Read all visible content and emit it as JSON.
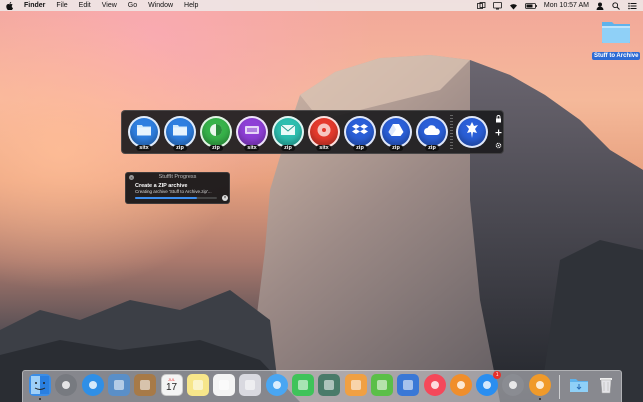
{
  "menubar": {
    "app_name": "Finder",
    "menus": [
      "File",
      "Edit",
      "View",
      "Go",
      "Window",
      "Help"
    ],
    "clock": "Mon 10:57 AM"
  },
  "desktop": {
    "folder_label": "Stuff to Archive"
  },
  "dropbar": {
    "items": [
      {
        "tag": "sitx",
        "icon": "folder-icon",
        "color": "#2f7fe0"
      },
      {
        "tag": "zip",
        "icon": "folder-icon",
        "color": "#2f7fe0"
      },
      {
        "tag": "zip",
        "icon": "share-icon",
        "color": "#37b34a"
      },
      {
        "tag": "sitx",
        "icon": "disc-image-icon",
        "color": "#8e3fd6"
      },
      {
        "tag": "zip",
        "icon": "mail-icon",
        "color": "#2dbfb0"
      },
      {
        "tag": "sitx",
        "icon": "burn-disc-icon",
        "color": "#e53a2c"
      },
      {
        "tag": "zip",
        "icon": "dropbox-icon",
        "color": "#2a5fd8"
      },
      {
        "tag": "zip",
        "icon": "google-drive-icon",
        "color": "#2a5fd8"
      },
      {
        "tag": "zip",
        "icon": "icloud-icon",
        "color": "#2a5fd8"
      }
    ],
    "stuffit_icon": "stuffit-logo-icon"
  },
  "progress": {
    "title": "StuffIt Progress",
    "heading": "Create a ZIP archive",
    "description": "Creating archive 'Stuff to Archive.zip'...",
    "fraction": 0.75
  },
  "dock": {
    "items": [
      {
        "name": "finder-icon",
        "color": "#3b8de6"
      },
      {
        "name": "launchpad-icon",
        "color": "#777a80"
      },
      {
        "name": "safari-icon",
        "color": "#2f8fe6"
      },
      {
        "name": "preview-icon",
        "color": "#5a8fc8"
      },
      {
        "name": "contacts-icon",
        "color": "#a77a48"
      },
      {
        "name": "calendar-icon",
        "color": "#f4f4f4"
      },
      {
        "name": "notes-icon",
        "color": "#f7e68a"
      },
      {
        "name": "reminders-icon",
        "color": "#f4f4f4"
      },
      {
        "name": "photos-icon",
        "color": "#d9d9e0"
      },
      {
        "name": "messages-icon",
        "color": "#49a6f2"
      },
      {
        "name": "facetime-icon",
        "color": "#3fc35a"
      },
      {
        "name": "photo-booth-icon",
        "color": "#4a7b6a"
      },
      {
        "name": "pages-icon",
        "color": "#f0a043"
      },
      {
        "name": "numbers-icon",
        "color": "#5bbf48"
      },
      {
        "name": "keynote-icon",
        "color": "#3a78d6"
      },
      {
        "name": "itunes-icon",
        "color": "#f5485a"
      },
      {
        "name": "ibooks-icon",
        "color": "#f08e2c"
      },
      {
        "name": "app-store-icon",
        "color": "#2a8ef0"
      },
      {
        "name": "system-preferences-icon",
        "color": "#8a8c92"
      },
      {
        "name": "stuffit-icon",
        "color": "#f09a2a"
      }
    ],
    "app_store_badge": "1",
    "calendar_month": "JUL",
    "calendar_day": "17",
    "downloads_icon": "downloads-folder-icon",
    "trash_icon": "trash-icon"
  }
}
